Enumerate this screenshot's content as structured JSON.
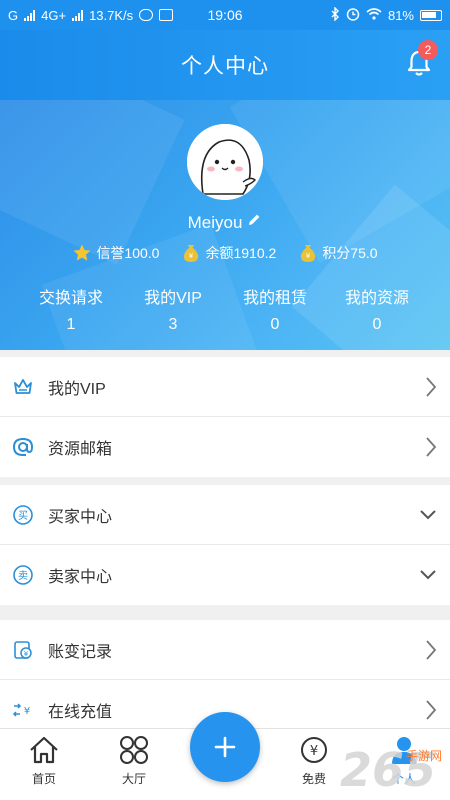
{
  "status_bar": {
    "carrier": "G",
    "network": "4G+",
    "speed": "13.7K/s",
    "time": "19:06",
    "battery": "81%"
  },
  "header": {
    "title": "个人中心",
    "notification_count": "2"
  },
  "profile": {
    "username": "Meiyou",
    "stats": [
      {
        "icon": "star-icon",
        "label": "信誉100.0"
      },
      {
        "icon": "money-bag-icon",
        "label": "余额1910.2"
      },
      {
        "icon": "money-bag-icon",
        "label": "积分75.0"
      }
    ],
    "counters": [
      {
        "label": "交换请求",
        "value": "1"
      },
      {
        "label": "我的VIP",
        "value": "3"
      },
      {
        "label": "我的租赁",
        "value": "0"
      },
      {
        "label": "我的资源",
        "value": "0"
      }
    ]
  },
  "menu": {
    "group1": [
      {
        "label": "我的VIP",
        "icon": "crown-icon"
      },
      {
        "label": "资源邮箱",
        "icon": "at-icon"
      }
    ],
    "group2": [
      {
        "label": "买家中心",
        "icon": "buy-icon",
        "icon_text": "买"
      },
      {
        "label": "卖家中心",
        "icon": "sell-icon",
        "icon_text": "卖"
      }
    ],
    "group3": [
      {
        "label": "账变记录",
        "icon": "ledger-icon"
      },
      {
        "label": "在线充值",
        "icon": "recharge-icon"
      }
    ]
  },
  "bottom_nav": {
    "items": [
      {
        "label": "首页",
        "icon": "home-icon"
      },
      {
        "label": "大厅",
        "icon": "grid-icon"
      },
      {
        "label": "免费",
        "icon": "free-icon"
      },
      {
        "label": "个人",
        "icon": "person-icon"
      }
    ],
    "fab_icon": "plus-icon"
  },
  "watermark": {
    "text": "265",
    "sub": "手游网"
  },
  "colors": {
    "primary": "#1e90ee",
    "accent_icon": "#2a8fd8",
    "badge": "#f55b5b",
    "gold": "#e8c23a"
  }
}
